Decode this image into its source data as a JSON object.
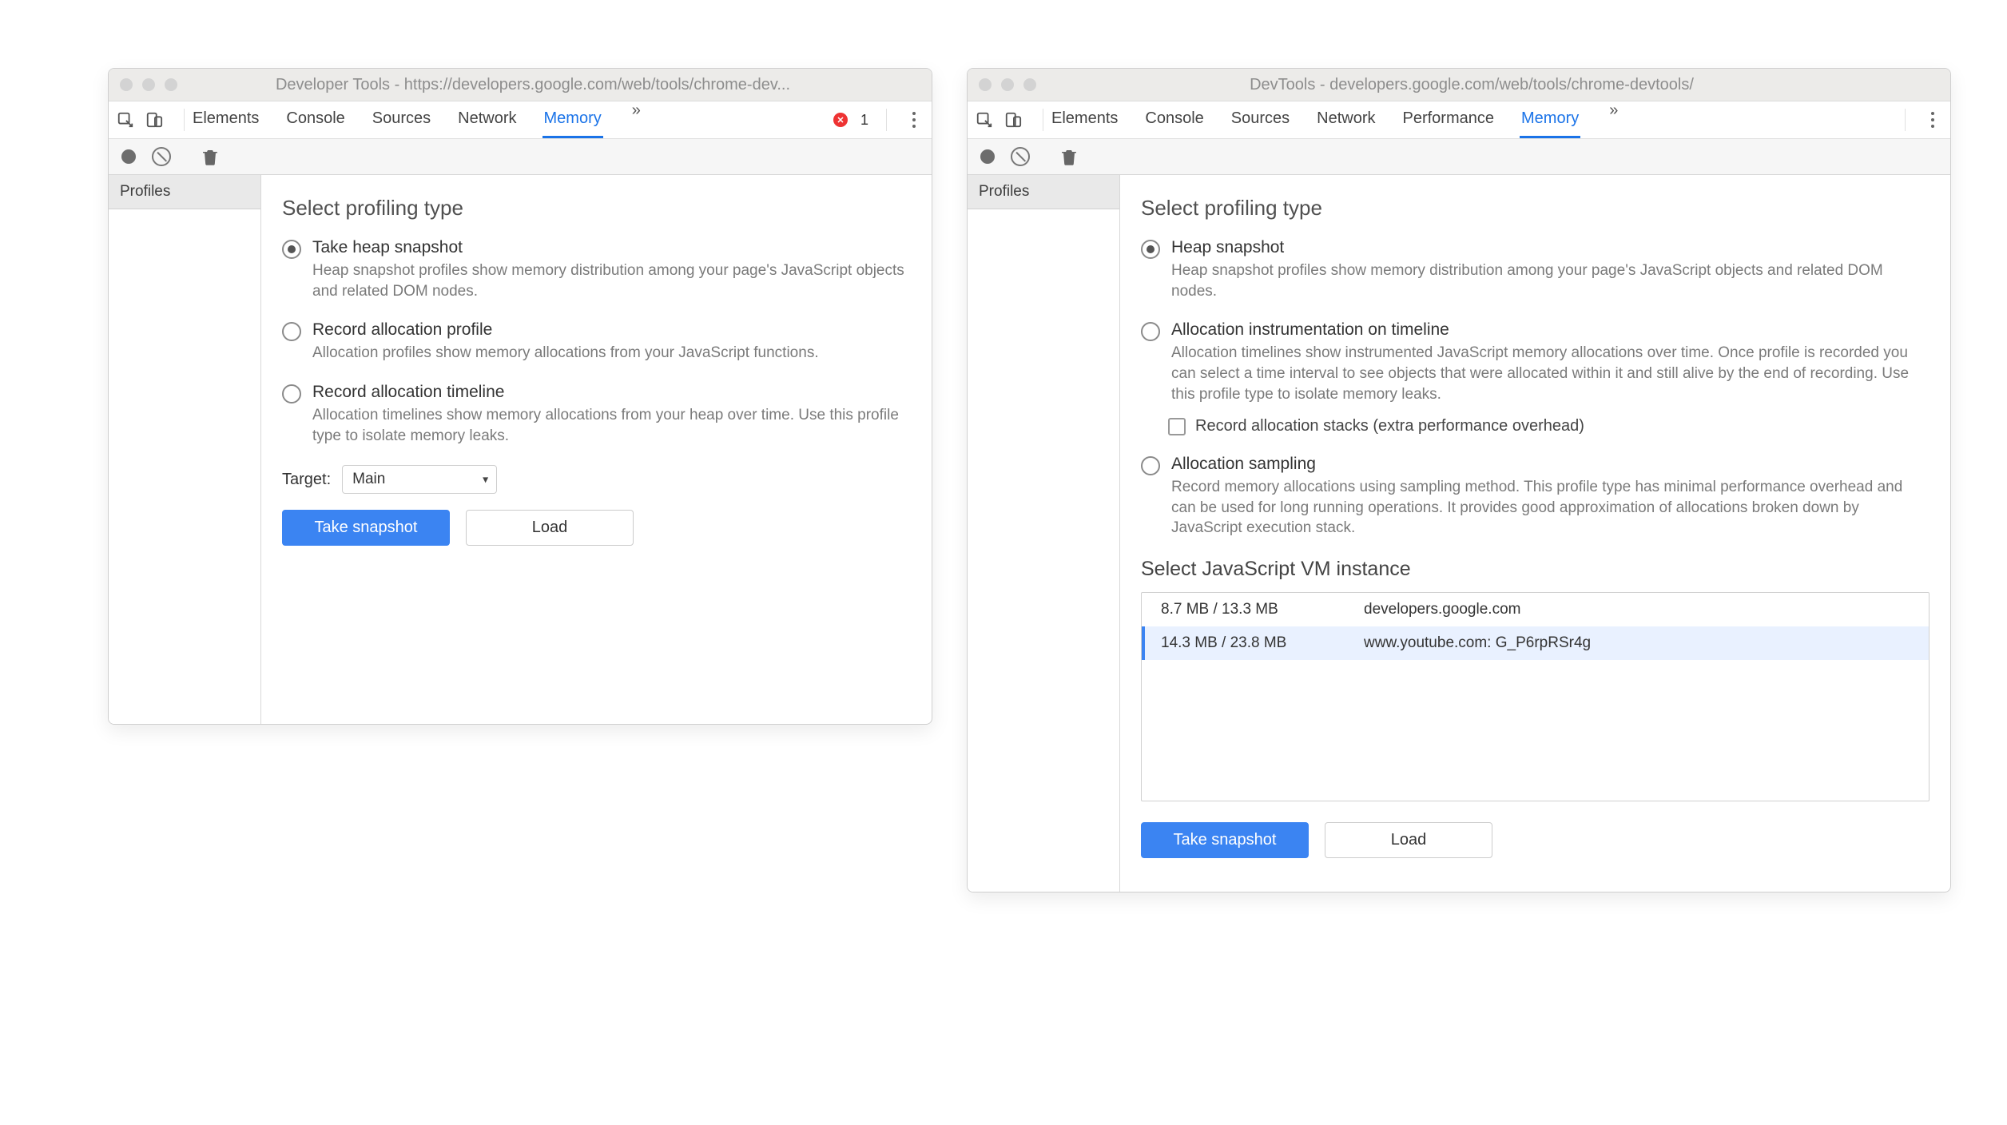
{
  "colors": {
    "accent": "#3b84f2"
  },
  "left": {
    "title": "Developer Tools - https://developers.google.com/web/tools/chrome-dev...",
    "tabs": {
      "items": [
        "Elements",
        "Console",
        "Sources",
        "Network",
        "Memory"
      ],
      "active": 4,
      "error_count": "1"
    },
    "sidebar": {
      "header": "Profiles"
    },
    "main": {
      "heading": "Select profiling type",
      "options": [
        {
          "title": "Take heap snapshot",
          "desc": "Heap snapshot profiles show memory distribution among your page's JavaScript objects and related DOM nodes.",
          "selected": true
        },
        {
          "title": "Record allocation profile",
          "desc": "Allocation profiles show memory allocations from your JavaScript functions.",
          "selected": false
        },
        {
          "title": "Record allocation timeline",
          "desc": "Allocation timelines show memory allocations from your heap over time. Use this profile type to isolate memory leaks.",
          "selected": false
        }
      ],
      "target_label": "Target:",
      "target_value": "Main",
      "take_snapshot_label": "Take snapshot",
      "load_label": "Load"
    }
  },
  "right": {
    "title": "DevTools - developers.google.com/web/tools/chrome-devtools/",
    "tabs": {
      "items": [
        "Elements",
        "Console",
        "Sources",
        "Network",
        "Performance",
        "Memory"
      ],
      "active": 5
    },
    "sidebar": {
      "header": "Profiles"
    },
    "main": {
      "heading": "Select profiling type",
      "options": [
        {
          "title": "Heap snapshot",
          "desc": "Heap snapshot profiles show memory distribution among your page's JavaScript objects and related DOM nodes.",
          "selected": true
        },
        {
          "title": "Allocation instrumentation on timeline",
          "desc": "Allocation timelines show instrumented JavaScript memory allocations over time. Once profile is recorded you can select a time interval to see objects that were allocated within it and still alive by the end of recording. Use this profile type to isolate memory leaks.",
          "selected": false
        },
        {
          "title": "Allocation sampling",
          "desc": "Record memory allocations using sampling method. This profile type has minimal performance overhead and can be used for long running operations. It provides good approximation of allocations broken down by JavaScript execution stack.",
          "selected": false
        }
      ],
      "alloc_stacks_label": "Record allocation stacks (extra performance overhead)",
      "vm_heading": "Select JavaScript VM instance",
      "vm_items": [
        {
          "size": "8.7 MB / 13.3 MB",
          "name": "developers.google.com",
          "selected": false
        },
        {
          "size": "14.3 MB / 23.8 MB",
          "name": "www.youtube.com: G_P6rpRSr4g",
          "selected": true
        }
      ],
      "take_snapshot_label": "Take snapshot",
      "load_label": "Load"
    }
  }
}
